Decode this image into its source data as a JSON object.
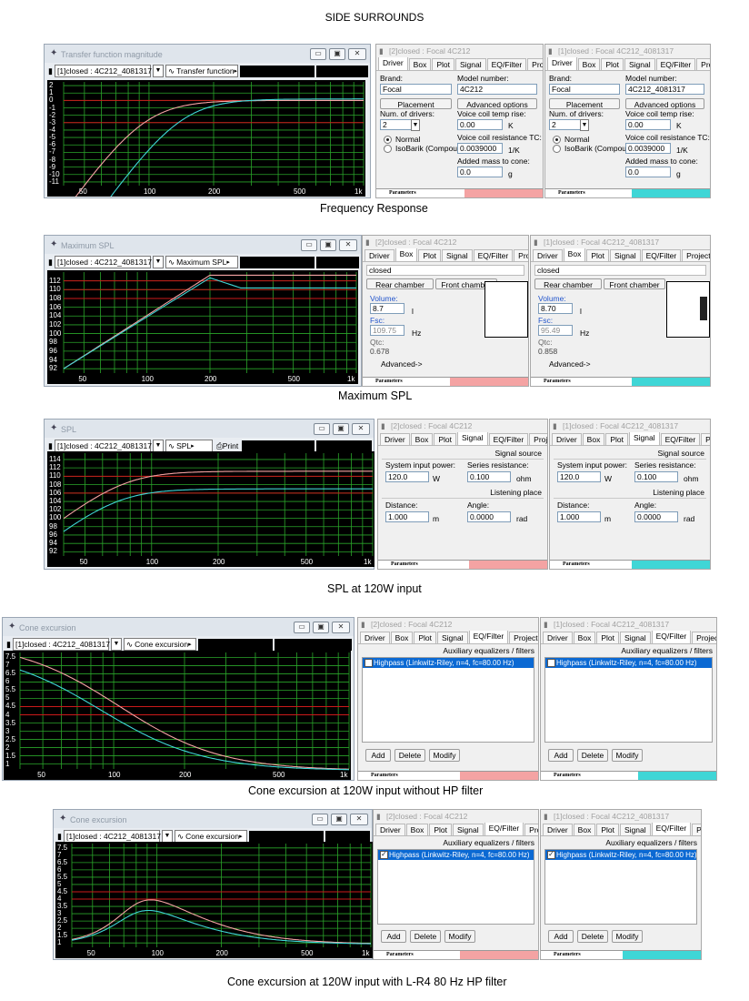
{
  "page_title": "SIDE SURROUNDS",
  "colors": {
    "series1": "#f4a3a3",
    "series2": "#3fd6d6",
    "grid": "#2aa52a",
    "ref": "#cc1a1a",
    "plotbg": "#000000"
  },
  "sections": [
    {
      "caption": "Frequency Response",
      "window_title": "Transfer function magnitude",
      "driver_combo": "[1]closed : 4C212_4081317",
      "view_combo": "Transfer function",
      "y_ticks": [
        "2",
        "1",
        "0",
        "-1",
        "-2",
        "-3",
        "-4",
        "-5",
        "-6",
        "-7",
        "-8",
        "-9",
        "-10",
        "-11"
      ],
      "x_ticks": [
        "50",
        "100",
        "200",
        "500",
        "1k"
      ],
      "panel_left_title": "[2]closed : Focal 4C212",
      "panel_right_title": "[1]closed : Focal 4C212_4081317",
      "tabs": [
        "Driver",
        "Box",
        "Plot",
        "Signal",
        "EQ/Filter",
        "Project"
      ],
      "active_tab": "Driver",
      "driver_tab": {
        "brand_label": "Brand:",
        "model_label": "Model number:",
        "placement_btn": "Placement",
        "advanced_btn": "Advanced options",
        "num_drivers_label": "Num. of drivers:",
        "num_drivers": "2",
        "normal_label": "Normal",
        "isobarik_label": "IsoBarik (Compound)",
        "vc_temp_label": "Voice coil temp rise:",
        "vc_temp": "0.00",
        "vc_temp_unit": "K",
        "vc_res_label": "Voice coil resistance TC:",
        "vc_res": "0.0039000",
        "vc_res_unit": "1/K",
        "mass_label": "Added mass to cone:",
        "mass": "0.0",
        "mass_unit": "g"
      },
      "left_values": {
        "brand": "Focal",
        "model": "4C212"
      },
      "right_values": {
        "brand": "Focal",
        "model": "4C212_4081317"
      },
      "footer_label": "Parameters"
    },
    {
      "caption": "Maximum SPL",
      "window_title": "Maximum SPL",
      "driver_combo": "[1]closed : 4C212_4081317",
      "view_combo": "Maximum SPL",
      "y_ticks": [
        "112",
        "110",
        "108",
        "106",
        "104",
        "102",
        "100",
        "98",
        "96",
        "94",
        "92"
      ],
      "x_ticks": [
        "50",
        "100",
        "200",
        "500",
        "1k"
      ],
      "panel_left_title": "[2]closed : Focal 4C212",
      "panel_right_title": "[1]closed : Focal 4C212_4081317",
      "tabs": [
        "Driver",
        "Box",
        "Plot",
        "Signal",
        "EQ/Filter",
        "Project"
      ],
      "active_tab": "Box",
      "box_tab": {
        "type": "closed",
        "rear_btn": "Rear chamber",
        "front_btn": "Front chamber",
        "volume_label": "Volume:",
        "volume_unit": "l",
        "fsc_label": "Fsc:",
        "fsc_unit": "Hz",
        "qtc_label": "Qtc:",
        "advanced": "Advanced->"
      },
      "left_values": {
        "volume": "8.7",
        "fsc": "109.75",
        "qtc": "0.678"
      },
      "right_values": {
        "volume": "8.70",
        "fsc": "95.49",
        "qtc": "0.858"
      },
      "footer_label": "Parameters"
    },
    {
      "caption": "SPL at 120W input",
      "window_title": "SPL",
      "driver_combo": "[1]closed : 4C212_4081317",
      "view_combo": "SPL",
      "print_label": "Print",
      "y_ticks": [
        "114",
        "112",
        "110",
        "108",
        "106",
        "104",
        "102",
        "100",
        "98",
        "96",
        "94",
        "92"
      ],
      "x_ticks": [
        "50",
        "100",
        "200",
        "500",
        "1k"
      ],
      "panel_left_title": "[2]closed : Focal 4C212",
      "panel_right_title": "[1]closed : Focal 4C212_4081317",
      "tabs": [
        "Driver",
        "Box",
        "Plot",
        "Signal",
        "EQ/Filter",
        "Project"
      ],
      "active_tab": "Signal",
      "signal_tab": {
        "source_hdr": "Signal source",
        "power_label": "System input power:",
        "power": "120.0",
        "power_unit": "W",
        "series_label": "Series resistance:",
        "series": "0.100",
        "series_unit": "ohm",
        "listen_hdr": "Listening place",
        "distance_label": "Distance:",
        "distance": "1.000",
        "distance_unit": "m",
        "angle_label": "Angle:",
        "angle": "0.0000",
        "angle_unit": "rad"
      },
      "footer_label": "Parameters"
    },
    {
      "caption": "Cone excursion at 120W input without HP filter",
      "window_title": "Cone excursion",
      "driver_combo": "[1]closed : 4C212_4081317",
      "view_combo": "Cone excursion",
      "y_ticks": [
        "7.5",
        "7",
        "6.5",
        "6",
        "5.5",
        "5",
        "4.5",
        "4",
        "3.5",
        "3",
        "2.5",
        "2",
        "1.5",
        "1"
      ],
      "x_ticks": [
        "50",
        "100",
        "200",
        "500",
        "1k"
      ],
      "panel_left_title": "[2]closed : Focal 4C212",
      "panel_right_title": "[1]closed : Focal 4C212_4081317",
      "tabs": [
        "Driver",
        "Box",
        "Plot",
        "Signal",
        "EQ/Filter",
        "Project"
      ],
      "active_tab": "EQ/Filter",
      "eq_tab": {
        "hdr": "Auxiliary equalizers / filters",
        "item": "Highpass (Linkwitz-Riley, n=4, fc=80.00 Hz)",
        "checked": false,
        "add": "Add",
        "delete": "Delete",
        "modify": "Modify"
      },
      "footer_label": "Parameters"
    },
    {
      "caption": "Cone excursion at 120W input with L-R4 80 Hz HP filter",
      "window_title": "Cone excursion",
      "driver_combo": "[1]closed : 4C212_4081317",
      "view_combo": "Cone excursion",
      "y_ticks": [
        "7.5",
        "7",
        "6.5",
        "6",
        "5.5",
        "5",
        "4.5",
        "4",
        "3.5",
        "3",
        "2.5",
        "2",
        "1.5",
        "1"
      ],
      "x_ticks": [
        "50",
        "100",
        "200",
        "500",
        "1k"
      ],
      "panel_left_title": "[2]closed : Focal 4C212",
      "panel_right_title": "[1]closed : Focal 4C212_4081317",
      "tabs": [
        "Driver",
        "Box",
        "Plot",
        "Signal",
        "EQ/Filter",
        "Project"
      ],
      "active_tab": "EQ/Filter",
      "eq_tab": {
        "hdr": "Auxiliary equalizers / filters",
        "item": "Highpass (Linkwitz-Riley, n=4, fc=80.00 Hz)",
        "checked": true,
        "add": "Add",
        "delete": "Delete",
        "modify": "Modify"
      },
      "footer_label": "Parameters"
    }
  ]
}
